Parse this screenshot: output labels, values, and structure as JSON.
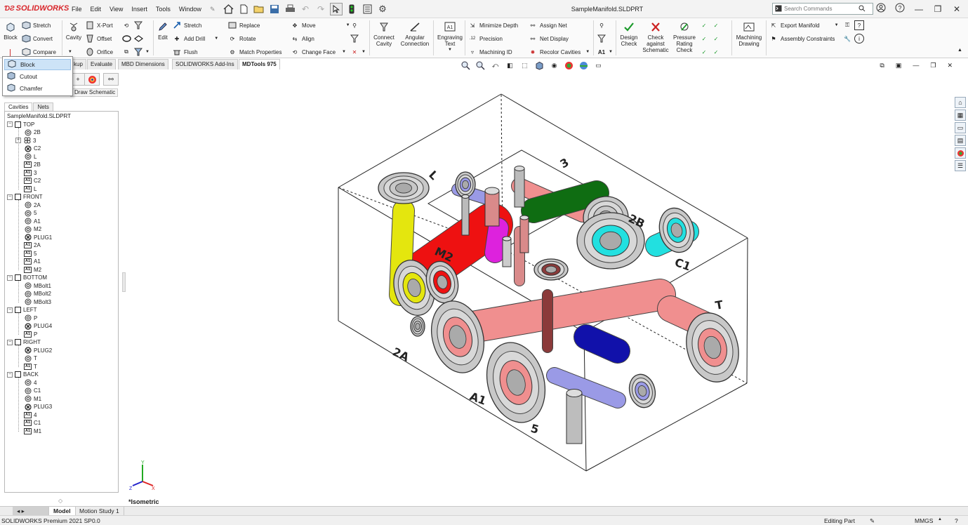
{
  "app": {
    "logo_text": "SOLIDWORKS",
    "document_title": "SampleManifold.SLDPRT",
    "menus": [
      "File",
      "Edit",
      "View",
      "Insert",
      "Tools",
      "Window"
    ]
  },
  "search": {
    "placeholder": "Search Commands"
  },
  "ribbon": {
    "block": "Block",
    "stretch": "Stretch",
    "convert": "Convert",
    "compare": "Compare",
    "cavity": "Cavity",
    "xport": "X-Port",
    "offset": "Offset",
    "orifice": "Orifice",
    "edit": "Edit",
    "stretch2": "Stretch",
    "add_drill": "Add Drill",
    "flush": "Flush",
    "replace": "Replace",
    "rotate": "Rotate",
    "match_properties": "Match Properties",
    "move": "Move",
    "align": "Align",
    "change_face": "Change Face",
    "connect_cavity": [
      "Connect",
      "Cavity"
    ],
    "angular_connection": [
      "Angular",
      "Connection"
    ],
    "engraving_text": [
      "Engraving",
      "Text"
    ],
    "minimize_depth": "Minimize Depth",
    "precision": "Precision",
    "machining_id": "Machining ID",
    "assign_net": "Assign Net",
    "net_display": "Net Display",
    "recolor_cavities": "Recolor Cavities",
    "design_check": [
      "Design",
      "Check"
    ],
    "check_against_schematic": [
      "Check",
      "against",
      "Schematic"
    ],
    "pressure_rating_check": [
      "Pressure",
      "Rating",
      "Check"
    ],
    "machining_drawing": [
      "Machining",
      "Drawing"
    ],
    "export_manifold": "Export Manifold",
    "assembly_constraints": "Assembly Constraints"
  },
  "flyout": {
    "items": [
      "Block",
      "Cutout",
      "Chamfer"
    ]
  },
  "tabs": [
    "kup",
    "Evaluate",
    "MBD Dimensions",
    "SOLIDWORKS Add-Ins",
    "MDTools 975"
  ],
  "panel": {
    "draw_schematic": "Draw Schematic",
    "tree_tabs": [
      "Cavities",
      "Nets"
    ],
    "root": "SampleManifold.SLDPRT",
    "groups": [
      {
        "name": "TOP",
        "children": [
          {
            "t": "circ",
            "label": "2B"
          },
          {
            "t": "quad",
            "label": "3",
            "exp": true
          },
          {
            "t": "x",
            "label": "C2"
          },
          {
            "t": "circ",
            "label": "L"
          },
          {
            "t": "box",
            "label": "2B"
          },
          {
            "t": "box",
            "label": "3"
          },
          {
            "t": "box",
            "label": "C2"
          },
          {
            "t": "box",
            "label": "L"
          }
        ]
      },
      {
        "name": "FRONT",
        "children": [
          {
            "t": "circ",
            "label": "2A"
          },
          {
            "t": "circ",
            "label": "5"
          },
          {
            "t": "circ",
            "label": "A1"
          },
          {
            "t": "circ",
            "label": "M2"
          },
          {
            "t": "x",
            "label": "PLUG1"
          },
          {
            "t": "box",
            "label": "2A"
          },
          {
            "t": "box",
            "label": "5"
          },
          {
            "t": "box",
            "label": "A1"
          },
          {
            "t": "box",
            "label": "M2"
          }
        ]
      },
      {
        "name": "BOTTOM",
        "children": [
          {
            "t": "circ",
            "label": "MBolt1"
          },
          {
            "t": "circ",
            "label": "MBolt2"
          },
          {
            "t": "circ",
            "label": "MBolt3"
          }
        ]
      },
      {
        "name": "LEFT",
        "children": [
          {
            "t": "circ",
            "label": "P"
          },
          {
            "t": "x",
            "label": "PLUG4"
          },
          {
            "t": "box",
            "label": "P"
          }
        ]
      },
      {
        "name": "RIGHT",
        "children": [
          {
            "t": "x",
            "label": "PLUG2"
          },
          {
            "t": "circ",
            "label": "T"
          },
          {
            "t": "box",
            "label": "T"
          }
        ]
      },
      {
        "name": "BACK",
        "children": [
          {
            "t": "circ",
            "label": "4"
          },
          {
            "t": "circ",
            "label": "C1"
          },
          {
            "t": "circ",
            "label": "M1"
          },
          {
            "t": "x",
            "label": "PLUG3"
          },
          {
            "t": "box",
            "label": "4"
          },
          {
            "t": "box",
            "label": "C1"
          },
          {
            "t": "box",
            "label": "M1"
          }
        ]
      }
    ],
    "box_icon_text": "A1"
  },
  "viewport": {
    "view_label": "*Isometric",
    "engravings": [
      "3",
      "L",
      "2B",
      "C1",
      "T",
      "2A",
      "A1",
      "5",
      "M2"
    ],
    "triad": {
      "x": "X",
      "y": "Y",
      "z": "Z"
    }
  },
  "bottom_tabs": [
    "Model",
    "Motion Study 1"
  ],
  "status": {
    "version": "SOLIDWORKS Premium 2021 SP0.0",
    "mode": "Editing Part",
    "units": "MMGS"
  },
  "colors": {
    "salmon": "#f08f8f",
    "red": "#ee1111",
    "magenta": "#dd22dd",
    "yellow": "#e4e60e",
    "green": "#0f6d12",
    "cyan": "#22e0e0",
    "lavender": "#9a9ae6",
    "navy": "#1111aa",
    "rust": "#8b3a3a",
    "gray": "#c8c8c8"
  }
}
